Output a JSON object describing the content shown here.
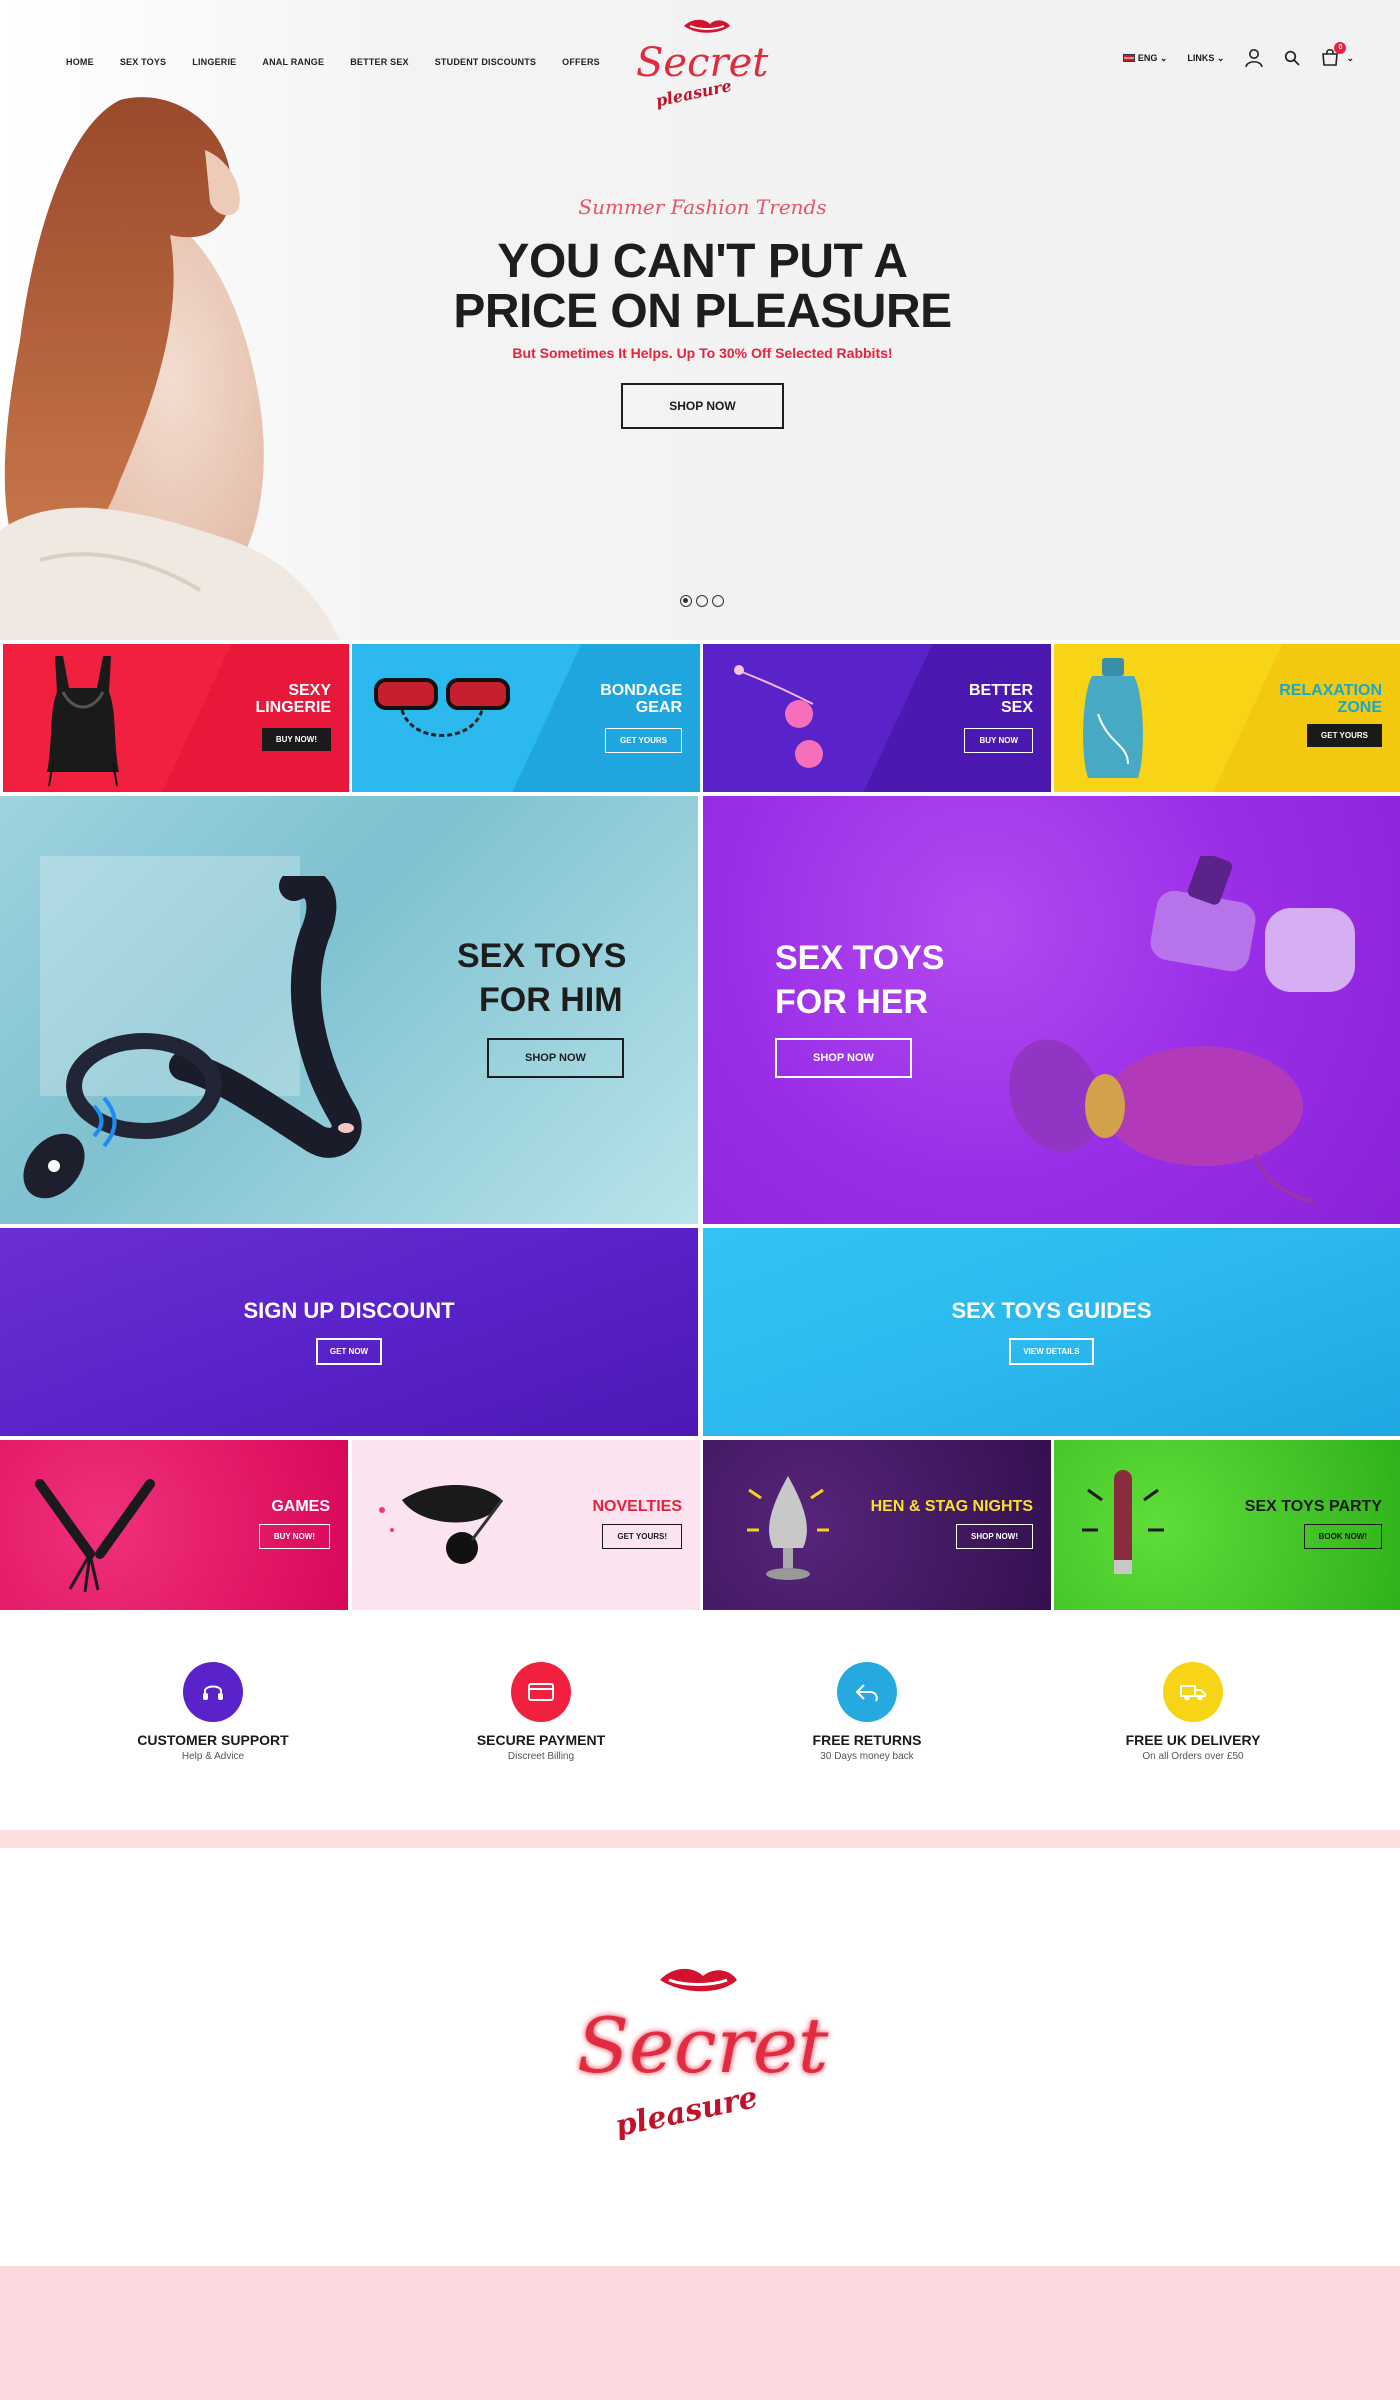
{
  "header": {
    "nav": [
      "HOME",
      "SEX TOYS",
      "LINGERIE",
      "ANAL RANGE",
      "BETTER SEX",
      "STUDENT DISCOUNTS",
      "OFFERS"
    ],
    "logo_text": "Secret",
    "logo_subtext": "pleasure",
    "lang": "ENG",
    "links": "LINKS",
    "cart_count": "0"
  },
  "hero": {
    "subtitle": "Summer Fashion Trends",
    "title_line1": "YOU CAN'T PUT A",
    "title_line2": "PRICE ON PLEASURE",
    "description": "But Sometimes It Helps. Up To 30% Off Selected Rabbits!",
    "button": "SHOP NOW",
    "slides": 3,
    "active_slide": 1
  },
  "categories": [
    {
      "line1": "SEXY",
      "line2": "LINGERIE",
      "button": "BUY NOW!",
      "bg": "#f2203f"
    },
    {
      "line1": "BONDAGE",
      "line2": "GEAR",
      "button": "GET YOURS",
      "bg": "#26b6ec"
    },
    {
      "line1": "BETTER",
      "line2": "SEX",
      "button": "BUY NOW",
      "bg": "#5a22c9"
    },
    {
      "line1": "RELAXATION",
      "line2": "ZONE",
      "button": "GET YOURS",
      "bg": "#f8d417"
    }
  ],
  "banners": {
    "him": {
      "line1": "SEX TOYS",
      "line2": "FOR HIM",
      "button": "SHOP NOW"
    },
    "her": {
      "line1": "SEX TOYS",
      "line2": "FOR HER",
      "button": "SHOP NOW"
    }
  },
  "promos": {
    "signup": {
      "title": "SIGN UP DISCOUNT",
      "button": "GET NOW"
    },
    "guides": {
      "title": "SEX TOYS GUIDES",
      "button": "VIEW DETAILS"
    }
  },
  "small_tiles": [
    {
      "title": "GAMES",
      "button": "BUY NOW!"
    },
    {
      "title": "NOVELTIES",
      "button": "GET YOURS!"
    },
    {
      "title": "HEN & STAG NIGHTS",
      "button": "SHOP NOW!"
    },
    {
      "title": "SEX TOYS PARTY",
      "button": "BOOK NOW!"
    }
  ],
  "features": [
    {
      "title": "CUSTOMER SUPPORT",
      "sub": "Help & Advice",
      "icon": "headset-icon",
      "color": "#5a22c9"
    },
    {
      "title": "SECURE PAYMENT",
      "sub": "Discreet Billing",
      "icon": "credit-card-icon",
      "color": "#f2203f"
    },
    {
      "title": "FREE RETURNS",
      "sub": "30 Days money back",
      "icon": "return-arrow-icon",
      "color": "#26a8e0"
    },
    {
      "title": "FREE UK DELIVERY",
      "sub": "On all Orders over £50",
      "icon": "truck-icon",
      "color": "#f8d417"
    }
  ],
  "footer": {
    "logo_text": "Secret",
    "logo_subtext": "pleasure"
  }
}
